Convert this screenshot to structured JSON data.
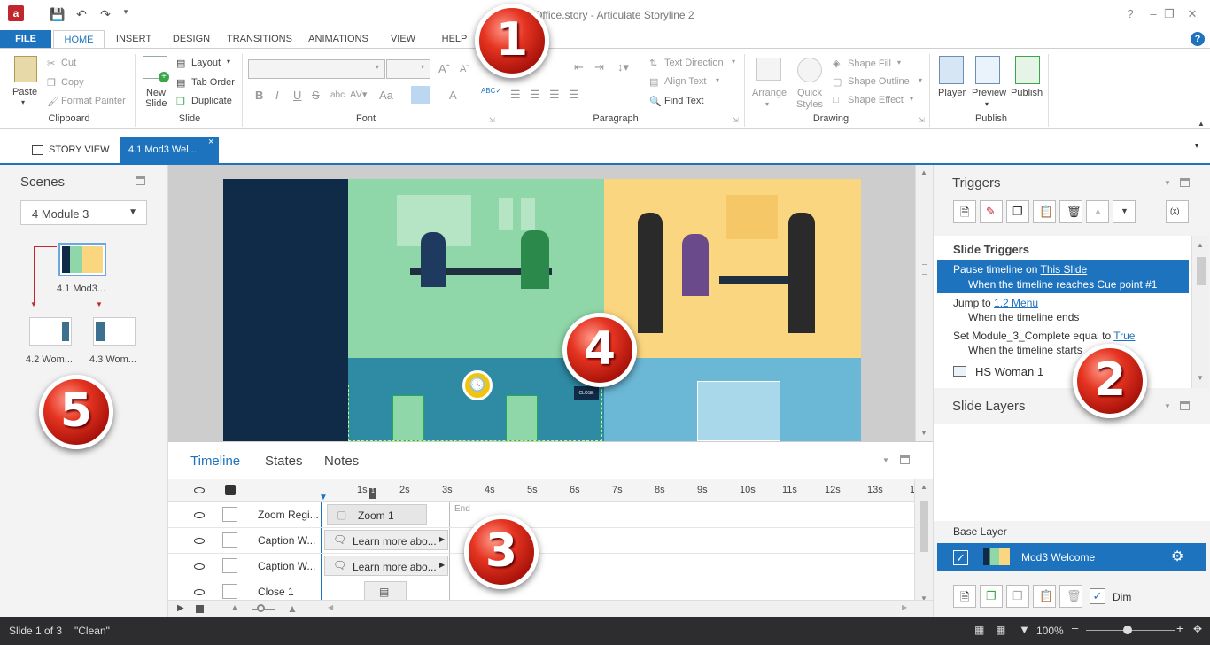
{
  "window": {
    "title": "...n-Office.story - Articulate Storyline 2",
    "app_icon_letter": "a"
  },
  "ribbon_tabs": [
    "FILE",
    "HOME",
    "INSERT",
    "DESIGN",
    "TRANSITIONS",
    "ANIMATIONS",
    "VIEW",
    "HELP"
  ],
  "help_label": "?",
  "clipboard": {
    "paste": "Paste",
    "cut": "Cut",
    "copy": "Copy",
    "format_painter": "Format Painter",
    "group": "Clipboard"
  },
  "slide_group": {
    "new_slide": "New Slide",
    "layout": "Layout",
    "tab_order": "Tab Order",
    "duplicate": "Duplicate",
    "group": "Slide"
  },
  "font_group": {
    "group": "Font",
    "bold": "B",
    "italic": "I",
    "underline": "U",
    "strike": "S",
    "aa": "Aa",
    "A": "A"
  },
  "paragraph_group": {
    "text_direction": "Text Direction",
    "align_text": "Align Text",
    "find_text": "Find Text",
    "group": "Paragraph"
  },
  "drawing_group": {
    "arrange": "Arrange",
    "quick_styles": "Quick Styles",
    "shape_fill": "Shape Fill",
    "shape_outline": "Shape Outline",
    "shape_effect": "Shape Effect",
    "group": "Drawing"
  },
  "publish_group": {
    "player": "Player",
    "preview": "Preview",
    "publish": "Publish",
    "group": "Publish"
  },
  "doc_tabs": {
    "story_view": "STORY VIEW",
    "active": "4.1 Mod3 Wel...",
    "close": "×"
  },
  "scenes": {
    "title": "Scenes",
    "selected_scene": "4 Module 3",
    "slides": [
      "4.1 Mod3...",
      "4.2 Wom...",
      "4.3 Wom..."
    ]
  },
  "stage": {
    "close_label": "CLOSE"
  },
  "timeline": {
    "tabs": [
      "Timeline",
      "States",
      "Notes"
    ],
    "ticks": [
      "1s",
      "2s",
      "3s",
      "4s",
      "5s",
      "6s",
      "7s",
      "8s",
      "9s",
      "10s",
      "11s",
      "12s",
      "13s",
      "1"
    ],
    "end_label": "End",
    "rows": [
      {
        "name": "Zoom Regi...",
        "bar": "Zoom 1"
      },
      {
        "name": "Caption W...",
        "bar": "Learn more abo..."
      },
      {
        "name": "Caption W...",
        "bar": "Learn more abo..."
      },
      {
        "name": "Close 1",
        "bar": ""
      }
    ]
  },
  "triggers": {
    "title": "Triggers",
    "section": "Slide Triggers",
    "items": [
      {
        "action": "Pause timeline on ",
        "link": "This Slide",
        "when": "When the timeline reaches Cue point #1"
      },
      {
        "action": "Jump to ",
        "link": "1.2 Menu",
        "when": "When the timeline ends"
      },
      {
        "action": "Set Module_3_Complete equal to ",
        "link": "True",
        "when": "When the timeline starts"
      }
    ],
    "object": "HS Woman 1"
  },
  "layers": {
    "title": "Slide Layers",
    "base_label": "Base Layer",
    "base_name": "Mod3 Welcome",
    "dim": "Dim"
  },
  "status": {
    "slide": "Slide 1 of 3",
    "theme": "\"Clean\"",
    "zoom": "100%"
  },
  "badges": [
    "1",
    "2",
    "3",
    "4",
    "5"
  ],
  "colors": {
    "accent": "#1e73be",
    "badge": "#e53421",
    "green_panel": "#8fd7a8",
    "yellow_panel": "#fad680",
    "blue_panel": "#6bb7d6",
    "navy": "#102b48"
  }
}
